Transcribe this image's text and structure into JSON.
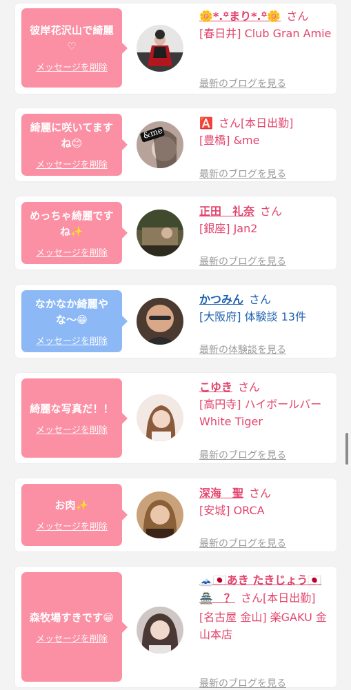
{
  "delete_label": "メッセージを削除",
  "san": "さん",
  "items": [
    {
      "message": "彼岸花沢山で綺麗♡",
      "name": "🌼*.꙳まり*.꙳🌼",
      "detail": "[春日井] Club Gran Amie",
      "link": "最新のブログを見る",
      "bubble_color": "pink"
    },
    {
      "message": "綺麗に咲いてますね😊",
      "name": "🅰️",
      "name_suffix": "[本日出勤]",
      "detail": "[豊橋] &me",
      "link": "最新のブログを見る",
      "bubble_color": "pink",
      "avatar_text": "&me"
    },
    {
      "message": "めっちゃ綺麗ですね✨",
      "name": "正田　礼奈",
      "detail": "[銀座] Jan2",
      "link": "最新のブログを見る",
      "bubble_color": "pink"
    },
    {
      "message": "なかなか綺麗やな〜😁",
      "name": "かつみん",
      "detail": "[大阪府] 体験談 13件",
      "link": "最新の体験談を見る",
      "bubble_color": "blue"
    },
    {
      "message": "綺麗な写真だ！！",
      "name": "こゆき",
      "detail": "[高円寺] ハイボールバー White Tiger",
      "link": "最新のブログを見る",
      "bubble_color": "pink"
    },
    {
      "message": "お肉✨",
      "name": "深海　聖",
      "detail": "[安城] ORCA",
      "link": "最新のブログを見る",
      "bubble_color": "pink"
    },
    {
      "message": "森牧場すきです😁",
      "name": "🗻🇯🇵あき たきじょう🇯🇵🏯　？",
      "name_suffix": "[本日出勤]",
      "detail": "[名古屋 金山] 楽GAKU 金山本店",
      "link": "最新のブログを見る",
      "bubble_color": "pink"
    }
  ],
  "colors": {
    "pink_bubble": "#fb8fa4",
    "blue_bubble": "#8cb8f5",
    "name_pink": "#e2446c",
    "name_blue": "#1f62b0",
    "link_gray": "#9a9a9a"
  }
}
